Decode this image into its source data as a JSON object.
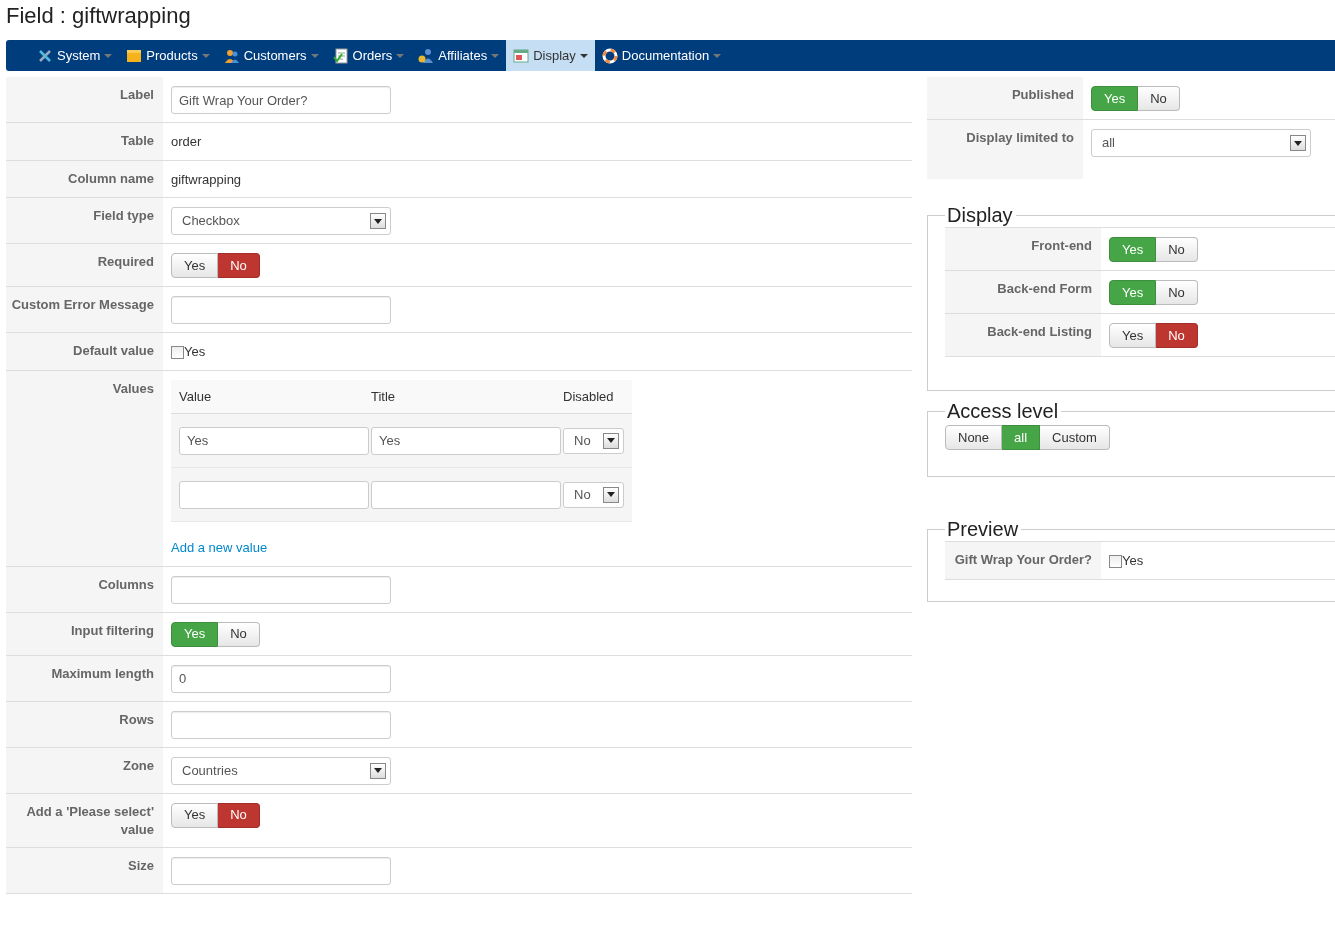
{
  "page_title": "Field : giftwrapping",
  "menu": [
    {
      "label": "System",
      "selected": false
    },
    {
      "label": "Products",
      "selected": false
    },
    {
      "label": "Customers",
      "selected": false
    },
    {
      "label": "Orders",
      "selected": false
    },
    {
      "label": "Affiliates",
      "selected": false
    },
    {
      "label": "Display",
      "selected": true
    },
    {
      "label": "Documentation",
      "selected": false
    }
  ],
  "form": {
    "rows": [
      {
        "kind": "input",
        "label": "Label",
        "value": "Gift Wrap Your Order?"
      },
      {
        "kind": "text",
        "label": "Table",
        "value": "order"
      },
      {
        "kind": "text",
        "label": "Column name",
        "value": "giftwrapping"
      },
      {
        "kind": "select",
        "label": "Field type",
        "value": "Checkbox"
      },
      {
        "kind": "toggle",
        "label": "Required",
        "options": [
          {
            "label": "Yes",
            "selected": false
          },
          {
            "label": "No",
            "selected": true
          }
        ]
      },
      {
        "kind": "input",
        "label": "Custom Error Message"
      },
      {
        "kind": "checkbox",
        "label": "Default value",
        "text": "Yes",
        "checked": false
      },
      {
        "kind": "values",
        "label": "Values",
        "columns": [
          "Value",
          "Title",
          "Disabled"
        ],
        "entries": [
          {
            "value": "Yes",
            "title": "Yes",
            "disabled": "No"
          },
          {
            "disabled": "No"
          }
        ],
        "link": "Add a new value"
      },
      {
        "kind": "input",
        "label": "Columns"
      },
      {
        "kind": "toggle",
        "label": "Input filtering",
        "options": [
          {
            "label": "Yes",
            "selected": true
          },
          {
            "label": "No",
            "selected": false
          }
        ]
      },
      {
        "kind": "input",
        "label": "Maximum length",
        "value": "0"
      },
      {
        "kind": "input",
        "label": "Rows"
      },
      {
        "kind": "select",
        "label": "Zone",
        "value": "Countries"
      },
      {
        "kind": "toggle",
        "label": "Add a 'Please select' value",
        "options": [
          {
            "label": "Yes",
            "selected": false
          },
          {
            "label": "No",
            "selected": true
          }
        ]
      },
      {
        "kind": "input",
        "label": "Size"
      }
    ]
  },
  "side": {
    "rows": [
      {
        "kind": "toggle",
        "label": "Published",
        "options": [
          {
            "label": "Yes",
            "selected": true
          },
          {
            "label": "No",
            "selected": false
          }
        ]
      },
      {
        "kind": "select",
        "label": "Display limited to",
        "value": "all"
      }
    ],
    "sections": [
      {
        "kind": "rows",
        "legend": "Display",
        "rows": [
          {
            "kind": "toggle",
            "label": "Front-end",
            "options": [
              {
                "label": "Yes",
                "selected": true
              },
              {
                "label": "No",
                "selected": false
              }
            ]
          },
          {
            "kind": "toggle",
            "label": "Back-end Form",
            "options": [
              {
                "label": "Yes",
                "selected": true
              },
              {
                "label": "No",
                "selected": false
              }
            ]
          },
          {
            "kind": "toggle",
            "label": "Back-end Listing",
            "options": [
              {
                "label": "Yes",
                "selected": false
              },
              {
                "label": "No",
                "selected": true
              }
            ]
          }
        ]
      },
      {
        "kind": "buttons",
        "legend": "Access level",
        "options": [
          {
            "label": "None",
            "selected": false
          },
          {
            "label": "all",
            "selected": true
          },
          {
            "label": "Custom",
            "selected": false
          }
        ]
      },
      {
        "kind": "rows",
        "legend": "Preview",
        "rows": [
          {
            "kind": "checkbox",
            "label": "Gift Wrap Your Order?",
            "text": "Yes",
            "checked": false
          }
        ]
      }
    ]
  }
}
